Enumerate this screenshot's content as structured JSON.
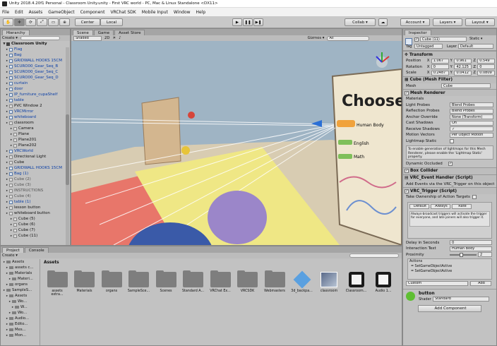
{
  "window": {
    "title": "Unity 2018.4.20f1 Personal - Classroom Unity.unity - First VRC world - PC, Mac & Linux Standalone <DX11>"
  },
  "menu": [
    "File",
    "Edit",
    "Assets",
    "GameObject",
    "Component",
    "VRChat SDK",
    "Mobile Input",
    "Window",
    "Help"
  ],
  "toolbar": {
    "center_label": "Center",
    "local_label": "Local",
    "collab_label": "Collab ▾",
    "account_label": "Account ▾",
    "layers_label": "Layers ▾",
    "layout_label": "Layout ▾"
  },
  "hierarchy": {
    "tab": "Hierarchy",
    "create": "Create ▾",
    "scene": "Classroom Unity",
    "rows": [
      {
        "label": "Flag",
        "style": "blue",
        "indent": 2,
        "icon": "cube"
      },
      {
        "label": "Bag",
        "style": "blue",
        "indent": 2,
        "icon": "cube"
      },
      {
        "label": "GRIDWALL HOOKS 15CM",
        "style": "blue",
        "indent": 2,
        "icon": "cube"
      },
      {
        "label": "SCURO00_Gear_Seq_B",
        "style": "blue",
        "indent": 2,
        "icon": "cube"
      },
      {
        "label": "SCURO00_Gear_Seq_C",
        "style": "blue",
        "indent": 2,
        "icon": "cube"
      },
      {
        "label": "SCURO00_Gear_Seq_D",
        "style": "blue",
        "indent": 2,
        "icon": "cube"
      },
      {
        "label": "curtain",
        "style": "blue",
        "indent": 2,
        "icon": "cube"
      },
      {
        "label": "door",
        "style": "blue",
        "indent": 2,
        "icon": "cube"
      },
      {
        "label": "IP_furniture_cupaShelf",
        "style": "blue",
        "indent": 2,
        "icon": "cube"
      },
      {
        "label": "table",
        "style": "blue",
        "indent": 2,
        "icon": "cube"
      },
      {
        "label": "PVC Window 2",
        "style": "",
        "indent": 2,
        "icon": "gray"
      },
      {
        "label": "VRCMirror",
        "style": "blue",
        "indent": 2,
        "icon": "cube"
      },
      {
        "label": "whiteboard",
        "style": "blue",
        "indent": 2,
        "icon": "cube"
      },
      {
        "label": "classroom",
        "style": "",
        "indent": 2,
        "icon": "gray"
      },
      {
        "label": "Camera",
        "style": "",
        "indent": 4,
        "icon": "gray"
      },
      {
        "label": "Plane",
        "style": "",
        "indent": 4,
        "icon": "gray"
      },
      {
        "label": "Plane201",
        "style": "",
        "indent": 4,
        "icon": "gray"
      },
      {
        "label": "Plane202",
        "style": "",
        "indent": 4,
        "icon": "gray"
      },
      {
        "label": "VRCWorld",
        "style": "blue",
        "indent": 2,
        "icon": "cube"
      },
      {
        "label": "Directional Light",
        "style": "",
        "indent": 2,
        "icon": "gray"
      },
      {
        "label": "Cube",
        "style": "",
        "indent": 2,
        "icon": "gray"
      },
      {
        "label": "GRIDWALL HOOKS 15CM",
        "style": "blue",
        "indent": 2,
        "icon": "cube"
      },
      {
        "label": "Bag (1)",
        "style": "blue",
        "indent": 2,
        "icon": "cube"
      },
      {
        "label": "Cube (2)",
        "style": "gray",
        "indent": 2,
        "icon": "gray"
      },
      {
        "label": "Cube (3)",
        "style": "gray",
        "indent": 2,
        "icon": "gray"
      },
      {
        "label": "INSTRUCTIONS",
        "style": "gray",
        "indent": 2,
        "icon": "gray"
      },
      {
        "label": "Cube (4)",
        "style": "gray",
        "indent": 2,
        "icon": "gray"
      },
      {
        "label": "table (1)",
        "style": "blue",
        "indent": 2,
        "icon": "cube"
      },
      {
        "label": "lesson button",
        "style": "",
        "indent": 2,
        "icon": "gray"
      },
      {
        "label": "whiteboard button",
        "style": "",
        "indent": 2,
        "icon": "gray"
      },
      {
        "label": "Cube (5)",
        "style": "",
        "indent": 4,
        "icon": "gray"
      },
      {
        "label": "Cube (6)",
        "style": "",
        "indent": 4,
        "icon": "gray"
      },
      {
        "label": "Cube (7)",
        "style": "",
        "indent": 4,
        "icon": "gray"
      },
      {
        "label": "Cube (11)",
        "style": "",
        "indent": 4,
        "icon": "gray"
      }
    ]
  },
  "scene": {
    "tabs": [
      "Scene",
      "Game",
      "Asset Store"
    ],
    "shading": "Shaded",
    "mode2d": "2D",
    "gizmos": "Gizmos ▾",
    "search": "All",
    "board_text": "Choose",
    "board_items": [
      "Human Body",
      "English",
      "Math"
    ]
  },
  "project": {
    "tabs": [
      "Project",
      "Console"
    ],
    "create": "Create ▾",
    "breadcrumb": "Assets",
    "tree": [
      {
        "label": "Assets",
        "indent": 0
      },
      {
        "label": "assets c...",
        "indent": 1
      },
      {
        "label": "Materials",
        "indent": 1
      },
      {
        "label": "Materi...",
        "indent": 2
      },
      {
        "label": "organs",
        "indent": 1
      },
      {
        "label": "SampleS...",
        "indent": 0
      },
      {
        "label": "Assets",
        "indent": 1
      },
      {
        "label": "Wo...",
        "indent": 2
      },
      {
        "label": "W...",
        "indent": 3
      },
      {
        "label": "Wo...",
        "indent": 2
      },
      {
        "label": "Audio...",
        "indent": 1
      },
      {
        "label": "Edito...",
        "indent": 1
      },
      {
        "label": "Mes...",
        "indent": 1
      },
      {
        "label": "Mon...",
        "indent": 1
      }
    ],
    "assets": [
      {
        "label": "assets extra...",
        "icon": "folder"
      },
      {
        "label": "Materials",
        "icon": "folder"
      },
      {
        "label": "organs",
        "icon": "folder"
      },
      {
        "label": "SampleSce...",
        "icon": "folder"
      },
      {
        "label": "Scenes",
        "icon": "folder"
      },
      {
        "label": "Standard A...",
        "icon": "folder"
      },
      {
        "label": "VRChat Ex...",
        "icon": "folder"
      },
      {
        "label": "VRCSDK",
        "icon": "folder"
      },
      {
        "label": "Webmasters",
        "icon": "folder"
      },
      {
        "label": "3d_backpa...",
        "icon": "cube"
      },
      {
        "label": "classroom",
        "icon": "model"
      },
      {
        "label": "Classroom...",
        "icon": "unity"
      },
      {
        "label": "Audio 1...",
        "icon": "unity"
      }
    ]
  },
  "inspector": {
    "tab": "Inspector",
    "object_name": "Cube (11)",
    "static_label": "Static ▾",
    "tag_label": "Tag",
    "tag_value": "Untagged",
    "layer_label": "Layer",
    "layer_value": "Default",
    "transform": {
      "title": "Transform",
      "rows": [
        {
          "label": "Position",
          "x": "1.067",
          "y": "0.961",
          "z": "0.549"
        },
        {
          "label": "Rotation",
          "x": "0",
          "y": "42.125",
          "z": "0"
        },
        {
          "label": "Scale",
          "x": "0.2487",
          "y": "0.0412",
          "z": "0.0809"
        }
      ]
    },
    "mesh_filter": {
      "title": "Cube (Mesh Filter)",
      "mesh_label": "Mesh",
      "mesh_value": "Cube"
    },
    "mesh_renderer": {
      "title": "Mesh Renderer",
      "rows": [
        {
          "label": "Materials",
          "value": ""
        },
        {
          "label": "Light Probes",
          "value": "Blend Probes"
        },
        {
          "label": "Reflection Probes",
          "value": "Blend Probes"
        },
        {
          "label": "Anchor Override",
          "value": "None (Transform)"
        },
        {
          "label": "Cast Shadows",
          "value": "On"
        },
        {
          "label": "Receive Shadows",
          "value": "✓"
        },
        {
          "label": "Motion Vectors",
          "value": "Per Object Motion"
        },
        {
          "label": "Lightmap Static",
          "value": ""
        }
      ],
      "note": "To enable generation of lightmaps for this Mesh Renderer, please enable the 'Lightmap Static' property.",
      "dynamic_occluded": "Dynamic Occluded"
    },
    "box_collider": {
      "title": "Box Collider"
    },
    "event_handler": {
      "title": "VRC_Event Handler (Script)",
      "subtitle": "Add Events via the VRC_Trigger on this object"
    },
    "trigger": {
      "title": "VRC_Trigger (Script)",
      "take_ownership": "Take Ownership of Action Targets",
      "buttons": [
        "Default",
        "Always",
        "Rate"
      ],
      "info": "Always-broadcast triggers will activate the trigger for everyone, and late joiners will also trigger it.",
      "delay_label": "Delay in Seconds",
      "delay_value": "0",
      "interaction_label": "Interaction Text",
      "interaction_value": "Human Body",
      "proximity_label": "Proximity",
      "proximity_value": "2",
      "actions_label": "Actions",
      "actions": [
        "SetGameObjectActive",
        "SetGameObjectActive"
      ],
      "custom_label": "Custom",
      "add_label": "Add"
    },
    "material": {
      "name": "button",
      "shader_label": "Shader",
      "shader_value": "Standard"
    },
    "add_component": "Add Component"
  },
  "colors": {
    "accent_orange": "#f0a23c",
    "floor_red": "#e8766a",
    "floor_yellow": "#efe785",
    "sphere_purple": "#9b86c9",
    "sphere_blue": "#3a5aa8"
  }
}
